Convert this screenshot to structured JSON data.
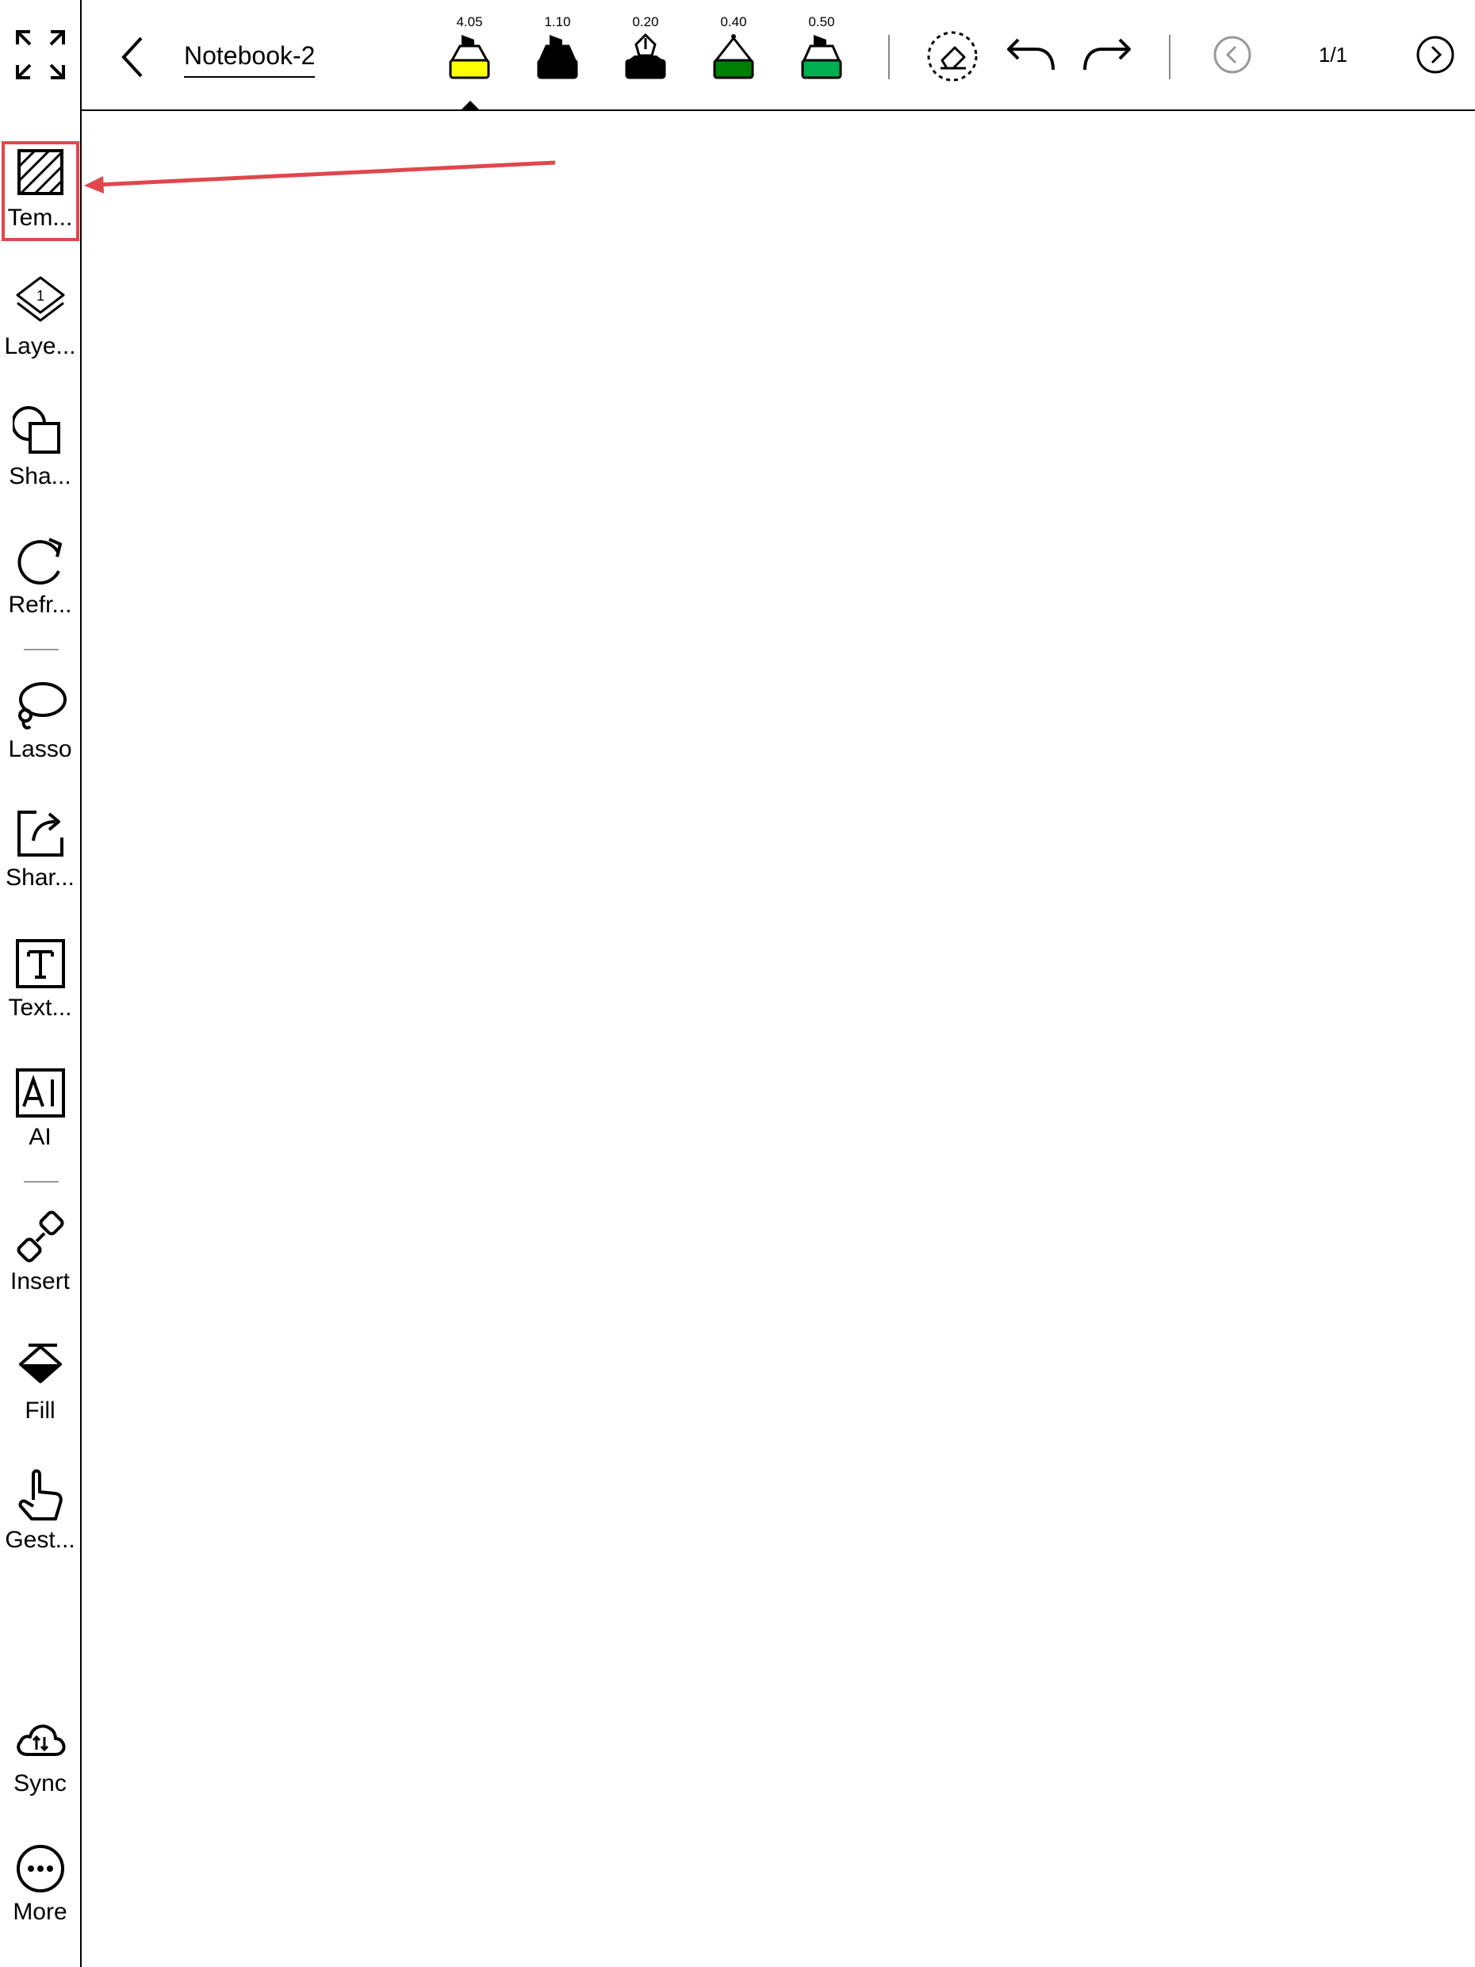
{
  "header": {
    "title": "Notebook-2",
    "page_indicator": "1/1"
  },
  "pens": [
    {
      "size": "4.05",
      "color": "#ffff00",
      "type": "highlighter-icon"
    },
    {
      "size": "1.10",
      "color": "#000000",
      "type": "marker-icon"
    },
    {
      "size": "0.20",
      "color": "#000000",
      "type": "fountain-pen-icon"
    },
    {
      "size": "0.40",
      "color": "#008000",
      "type": "ballpoint-pen-icon"
    },
    {
      "size": "0.50",
      "color": "#00b050",
      "type": "marker-icon"
    }
  ],
  "sidebar": {
    "items": [
      {
        "label": "Tem...",
        "icon": "template-icon"
      },
      {
        "label": "Laye...",
        "icon": "layers-icon",
        "badge": "1"
      },
      {
        "label": "Sha...",
        "icon": "shapes-icon"
      },
      {
        "label": "Refr...",
        "icon": "refresh-icon"
      },
      {
        "label": "Lasso",
        "icon": "lasso-icon"
      },
      {
        "label": "Shar...",
        "icon": "share-icon"
      },
      {
        "label": "Text...",
        "icon": "text-icon"
      },
      {
        "label": "AI",
        "icon": "ai-icon"
      },
      {
        "label": "Insert",
        "icon": "insert-link-icon"
      },
      {
        "label": "Fill",
        "icon": "fill-bucket-icon"
      },
      {
        "label": "Gest...",
        "icon": "gesture-hand-icon"
      },
      {
        "label": "Sync",
        "icon": "cloud-sync-icon"
      },
      {
        "label": "More",
        "icon": "more-icon"
      }
    ]
  },
  "annotation": {
    "color": "#e0474c",
    "target": "template"
  }
}
